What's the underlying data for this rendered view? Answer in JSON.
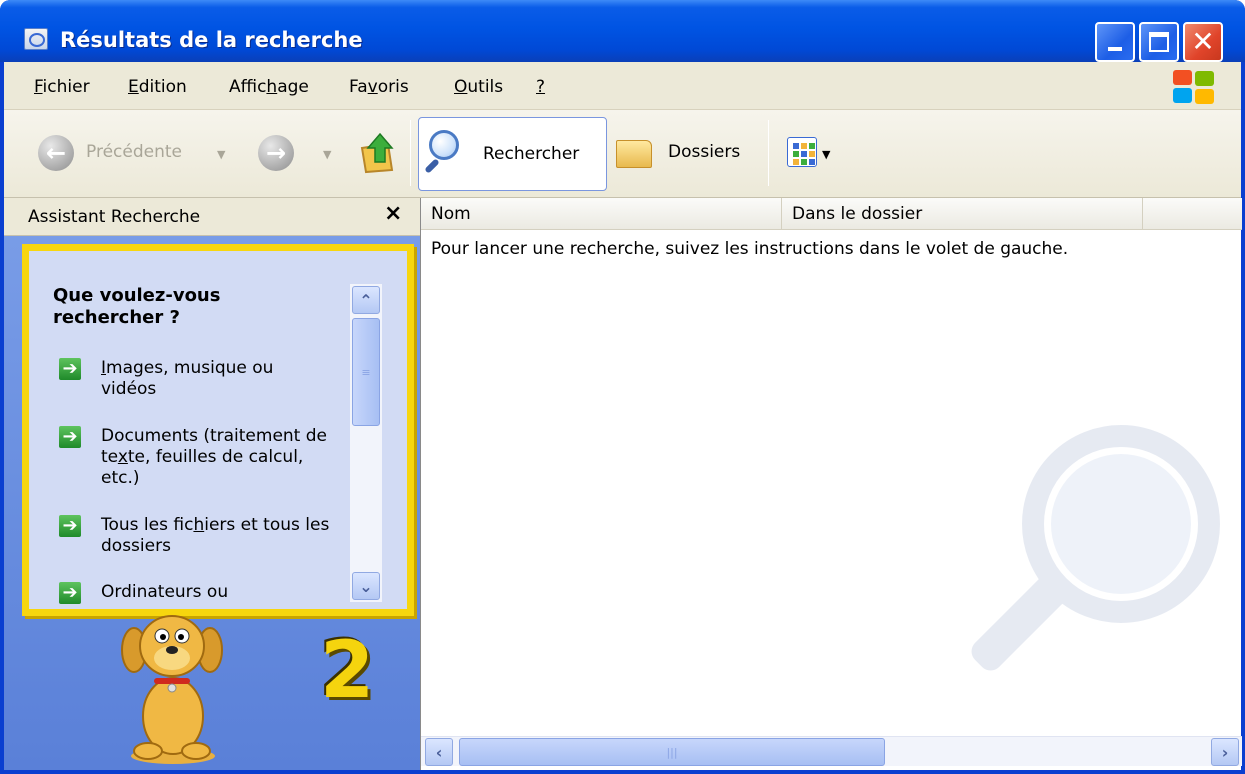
{
  "window": {
    "title": "Résultats de la recherche",
    "controls": [
      "minimize-icon",
      "maximize-icon",
      "close-icon"
    ]
  },
  "menu": {
    "items": [
      {
        "label": "Fichier",
        "hotkey": "F"
      },
      {
        "label": "Edition",
        "hotkey": "E"
      },
      {
        "label": "Affichage",
        "hotkey": "h"
      },
      {
        "label": "Favoris",
        "hotkey": "v"
      },
      {
        "label": "Outils",
        "hotkey": "O"
      },
      {
        "label": "?",
        "hotkey": "?"
      }
    ]
  },
  "toolbar": {
    "back_label": "Précédente",
    "search_label": "Rechercher",
    "folders_label": "Dossiers"
  },
  "left_pane": {
    "title": "Assistant Recherche",
    "close_glyph": "×",
    "question": "Que voulez-vous rechercher ?",
    "options": [
      "Images, musique ou vidéos",
      "Documents (traitement de texte, feuilles de calcul, etc.)",
      "Tous les fichiers et tous les dossiers",
      "Ordinateurs ou"
    ],
    "annotation_number": "2",
    "highlight_color": "#f7d60e"
  },
  "right_pane": {
    "columns": [
      "Nom",
      "Dans le dossier"
    ],
    "hint": "Pour lancer une recherche, suivez les instructions dans le volet de gauche."
  },
  "colors": {
    "titlebar": "#0054e3",
    "chrome": "#ece9d8",
    "pane_background": "#6a8fe0"
  }
}
